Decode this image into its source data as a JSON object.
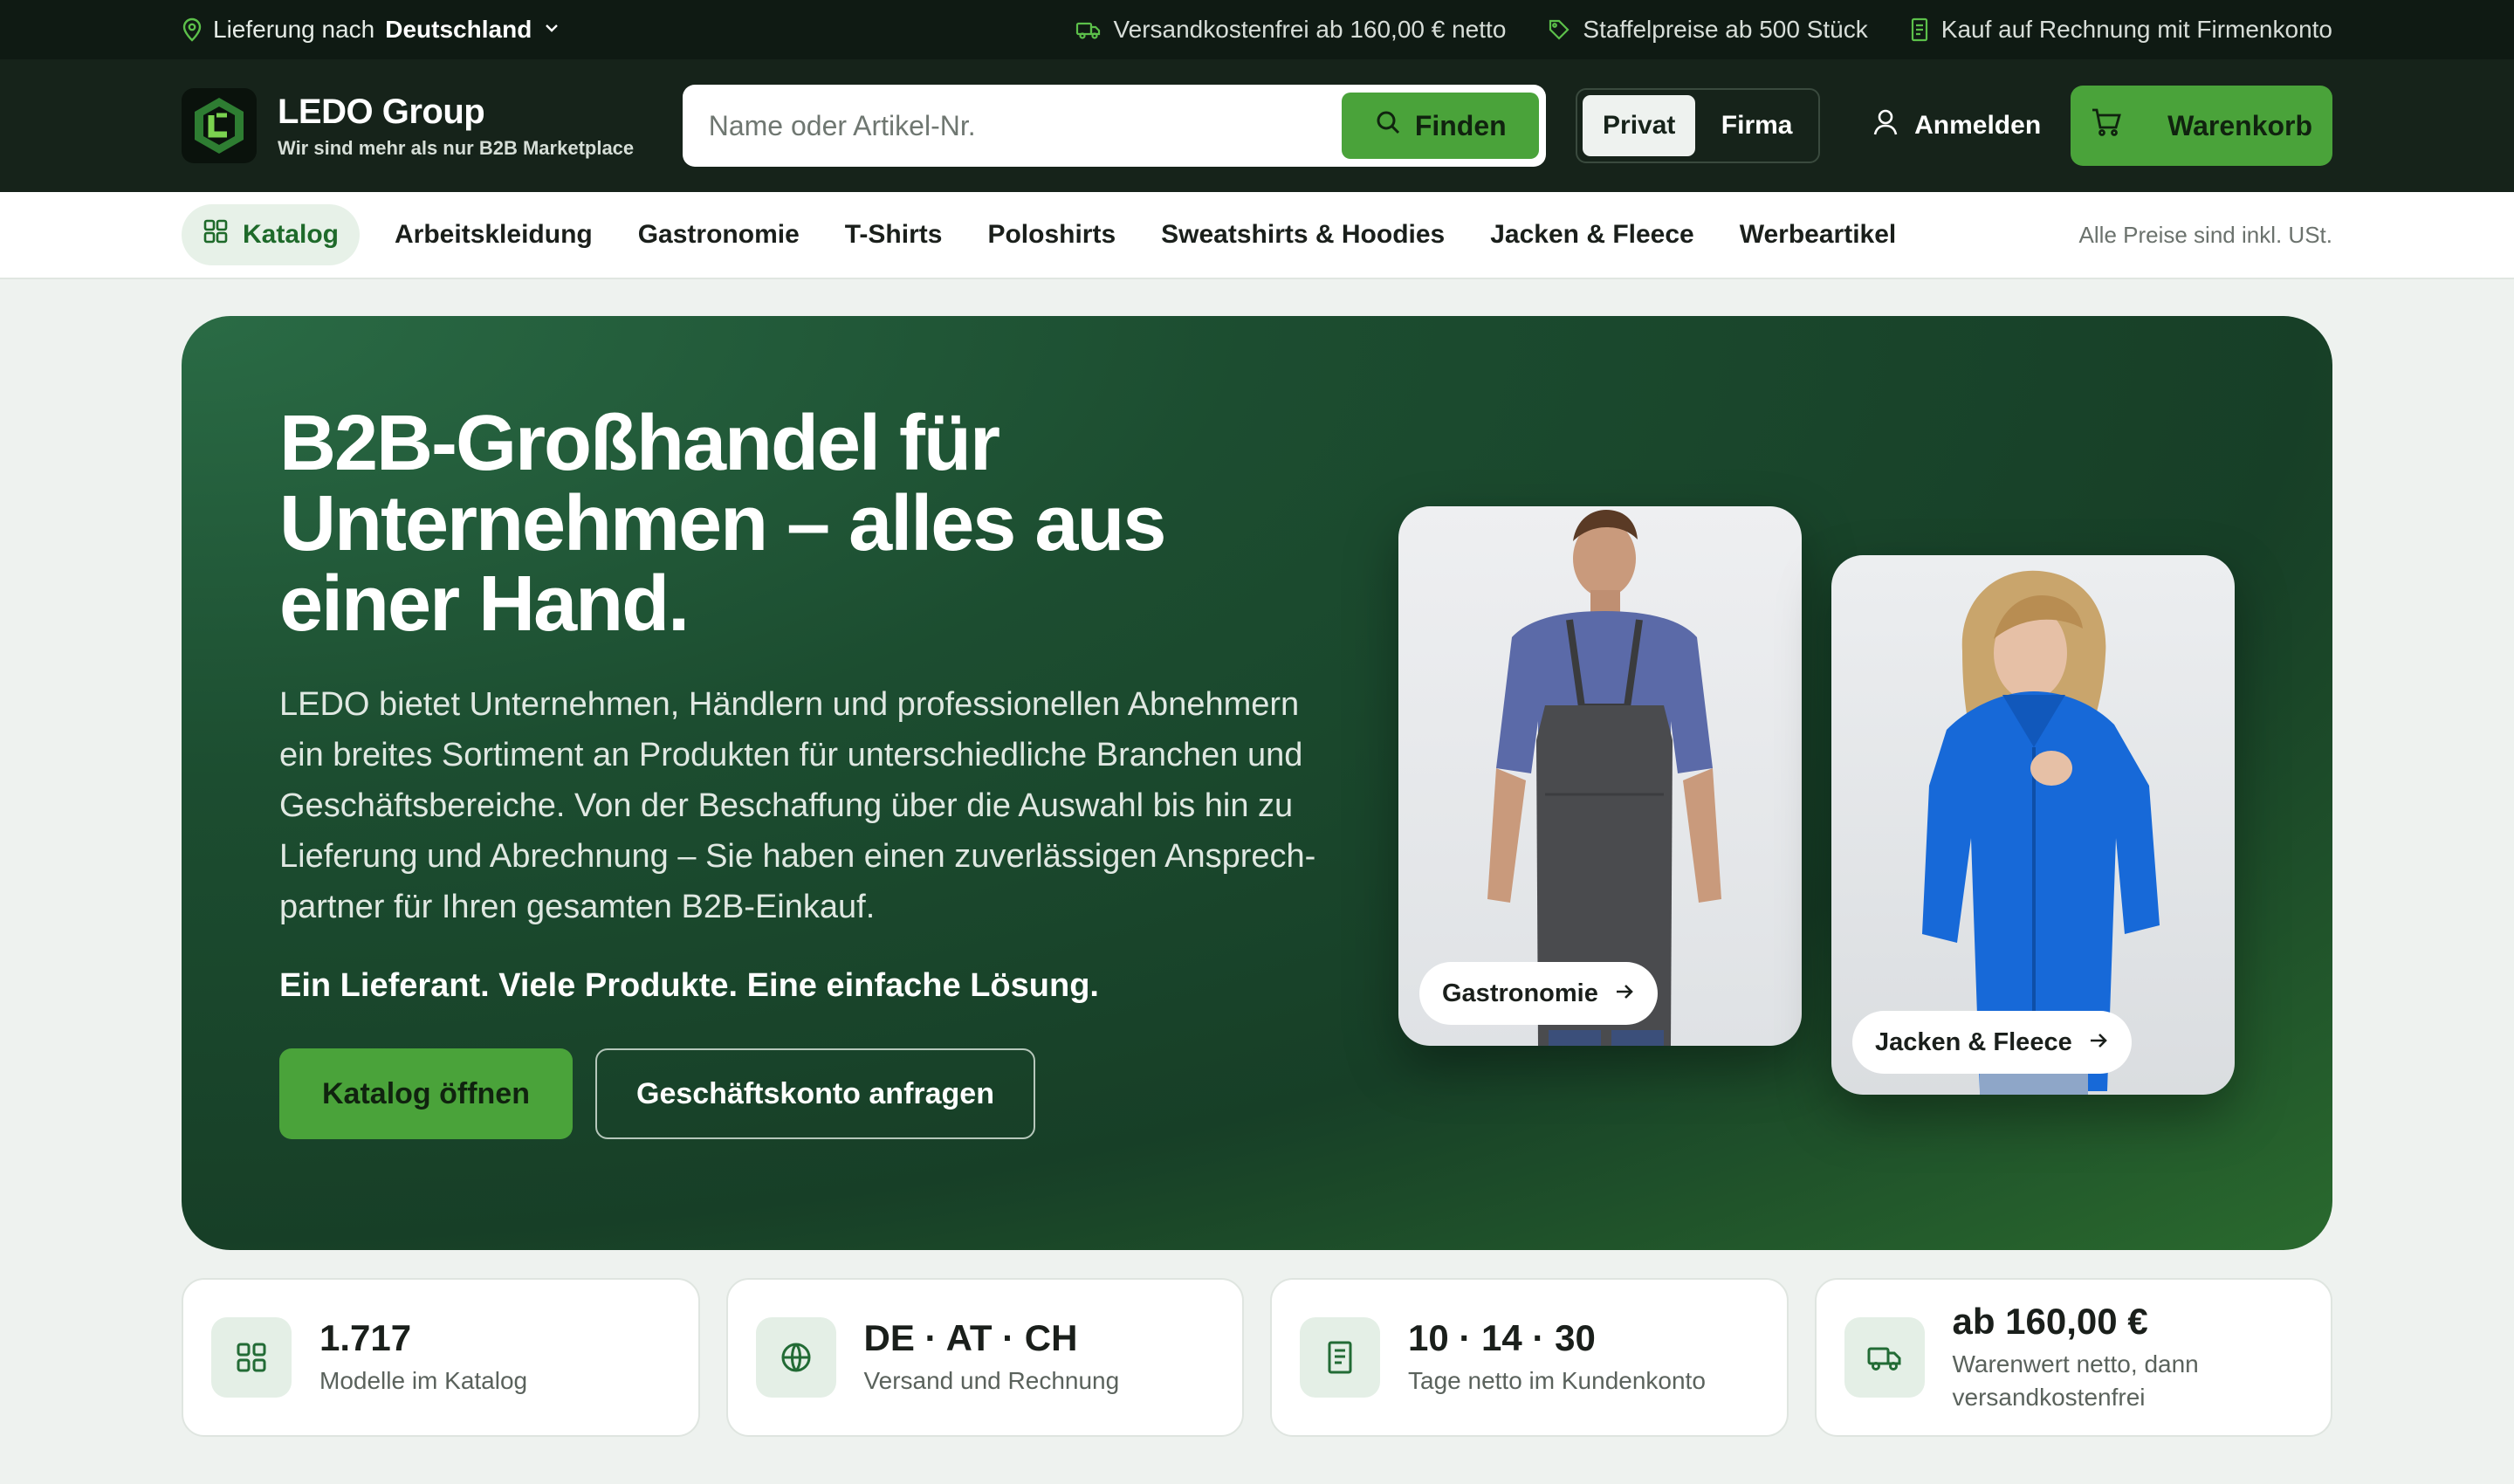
{
  "topbar": {
    "delivery_prefix": "Lieferung nach",
    "delivery_country": "Deutschland",
    "items": [
      {
        "icon": "truck-icon",
        "text": "Versandkostenfrei ab 160,00 € netto"
      },
      {
        "icon": "tag-icon",
        "text": "Staffelpreise ab 500 Stück"
      },
      {
        "icon": "receipt-icon",
        "text": "Kauf auf Rechnung mit Firmenkonto"
      }
    ]
  },
  "header": {
    "brand_title": "LEDO Group",
    "brand_subtitle": "Wir sind mehr als nur B2B Marketplace",
    "search_placeholder": "Name oder Artikel-Nr.",
    "search_button": "Finden",
    "segment": {
      "options": [
        "Privat",
        "Firma"
      ],
      "selected": "Privat"
    },
    "login_label": "Anmelden",
    "cart_label": "Warenkorb"
  },
  "nav": {
    "catalog_label": "Katalog",
    "links": [
      "Arbeitskleidung",
      "Gastronomie",
      "T-Shirts",
      "Poloshirts",
      "Sweatshirts & Hoodies",
      "Jacken & Fleece",
      "Werbeartikel"
    ],
    "price_note": "Alle Preise sind inkl. USt."
  },
  "hero": {
    "title": "B2B-Großhandel für Unternehmen – alles aus einer Hand.",
    "description": "LEDO bietet Unternehmen, Händlern und professionellen Abnehmern ein breites Sortiment an Produkten für unterschiedliche Branchen und Geschäftsbereiche. Von der Beschaffung über die Auswahl bis hin zu Lieferung und Abrechnung – Sie haben einen zuverlässigen Ansprech-partner für Ihren gesamten B2B-Einkauf.",
    "tagline": "Ein Lieferant. Viele Produkte. Eine einfache Lösung.",
    "primary_button": "Katalog öffnen",
    "secondary_button": "Geschäftskonto anfragen",
    "cards": [
      {
        "label": "Gastronomie"
      },
      {
        "label": "Jacken & Fleece"
      }
    ]
  },
  "stats": [
    {
      "icon": "grid-icon",
      "value": "1.717",
      "label": "Modelle im Katalog"
    },
    {
      "icon": "globe-icon",
      "value": "DE · AT · CH",
      "label": "Versand und Rechnung"
    },
    {
      "icon": "receipt-icon",
      "value": "10 · 14 · 30",
      "label": "Tage netto im Kundenkonto"
    },
    {
      "icon": "truck-icon",
      "value": "ab 160,00 €",
      "label": "Warenwert netto, dann versandkostenfrei"
    }
  ],
  "colors": {
    "accent_green": "#4aa33a",
    "header_dark": "#16231a",
    "topbar_dark": "#0f1a13",
    "hero_green": "#1c4d30"
  }
}
